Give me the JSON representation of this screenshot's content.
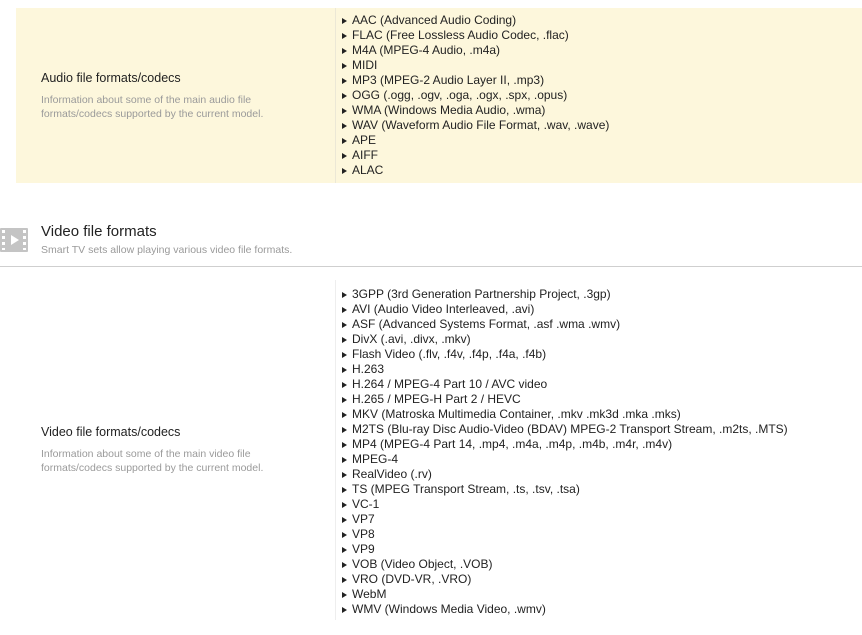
{
  "audio": {
    "title": "Audio file formats/codecs",
    "description": "Information about some of the main audio file formats/codecs supported by the current model.",
    "items": [
      "AAC (Advanced Audio Coding)",
      "FLAC (Free Lossless Audio Codec, .flac)",
      "M4A (MPEG-4 Audio, .m4a)",
      "MIDI",
      "MP3 (MPEG-2 Audio Layer II, .mp3)",
      "OGG (.ogg, .ogv, .oga, .ogx, .spx, .opus)",
      "WMA (Windows Media Audio, .wma)",
      "WAV (Waveform Audio File Format, .wav, .wave)",
      "APE",
      "AIFF",
      "ALAC"
    ]
  },
  "video_section": {
    "icon": "film-icon",
    "title": "Video file formats",
    "subtitle": "Smart TV sets allow playing various video file formats."
  },
  "video": {
    "title": "Video file formats/codecs",
    "description": "Information about some of the main video file formats/codecs supported by the current model.",
    "items": [
      "3GPP (3rd Generation Partnership Project, .3gp)",
      "AVI (Audio Video Interleaved, .avi)",
      "ASF (Advanced Systems Format, .asf .wma .wmv)",
      "DivX (.avi, .divx, .mkv)",
      "Flash Video (.flv, .f4v, .f4p, .f4a, .f4b)",
      "H.263",
      "H.264 / MPEG-4 Part 10 / AVC video",
      "H.265 / MPEG-H Part 2 / HEVC",
      "MKV (Matroska Multimedia Container, .mkv .mk3d .mka .mks)",
      "M2TS (Blu-ray Disc Audio-Video (BDAV) MPEG-2 Transport Stream, .m2ts, .MTS)",
      "MP4 (MPEG-4 Part 14, .mp4, .m4a, .m4p, .m4b, .m4r, .m4v)",
      "MPEG-4",
      "RealVideo (.rv)",
      "TS (MPEG Transport Stream, .ts, .tsv, .tsa)",
      "VC-1",
      "VP7",
      "VP8",
      "VP9",
      "VOB (Video Object, .VOB)",
      "VRO (DVD-VR, .VRO)",
      "WebM",
      "WMV (Windows Media Video, .wmv)"
    ]
  }
}
